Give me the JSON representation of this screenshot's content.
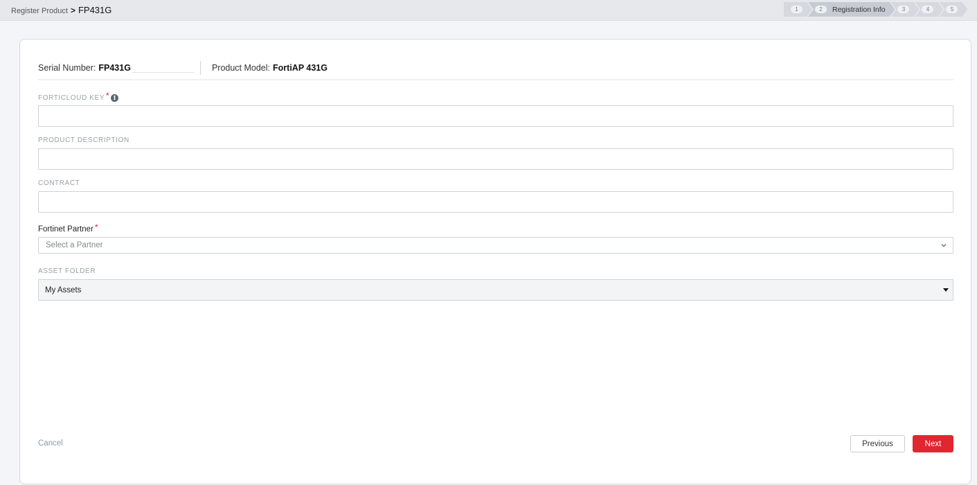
{
  "breadcrumb": {
    "root": "Register Product",
    "separator": ">",
    "current": "FP431G"
  },
  "steps": [
    {
      "num": "1",
      "label": ""
    },
    {
      "num": "2",
      "label": "Registration Info",
      "active": true
    },
    {
      "num": "3",
      "label": ""
    },
    {
      "num": "4",
      "label": ""
    },
    {
      "num": "5",
      "label": ""
    }
  ],
  "header": {
    "serial_label": "Serial Number:",
    "serial_value": "FP431G",
    "model_label": "Product Model:",
    "model_value": "FortiAP 431G"
  },
  "fields": {
    "forticloud_key": {
      "label": "FORTICLOUD KEY",
      "required": "*",
      "value": "",
      "icon": "info-icon"
    },
    "product_description": {
      "label": "PRODUCT DESCRIPTION",
      "value": ""
    },
    "contract": {
      "label": "CONTRACT",
      "value": ""
    },
    "partner": {
      "label": "Fortinet Partner",
      "required": "*",
      "placeholder": "Select a Partner",
      "icon": "chevron-down-icon"
    },
    "asset_folder": {
      "label": "ASSET FOLDER",
      "value": "My Assets",
      "icon": "caret-down-icon"
    }
  },
  "actions": {
    "cancel": "Cancel",
    "previous": "Previous",
    "next": "Next"
  },
  "colors": {
    "accent": "#e0262f",
    "link": "#8a9aa8",
    "background": "#f4f5f8"
  }
}
